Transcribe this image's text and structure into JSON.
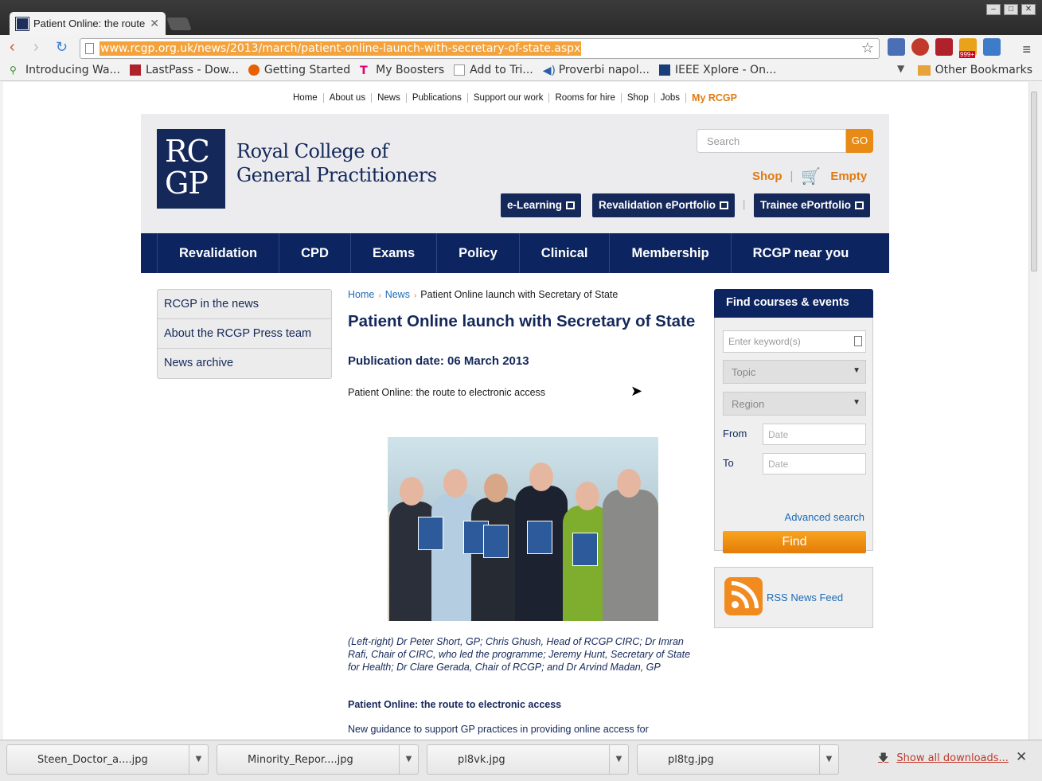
{
  "browser": {
    "tab_title": "Patient Online: the route",
    "url": "www.rcgp.org.uk/news/2013/march/patient-online-launch-with-secretary-of-state.aspx",
    "bookmarks": [
      "Introducing Wa...",
      "LastPass - Dow...",
      "Getting Started",
      "My Boosters",
      "Add to Tri...",
      "Proverbi napol...",
      "IEEE Xplore - On..."
    ],
    "other_bookmarks": "Other Bookmarks",
    "ext_badge": "999+"
  },
  "site": {
    "util_nav": [
      "Home",
      "About us",
      "News",
      "Publications",
      "Support our work",
      "Rooms for hire",
      "Shop",
      "Jobs",
      "My RCGP"
    ],
    "logo_mark_1": "RC",
    "logo_mark_2": "GP",
    "logo_line_1": "Royal College of",
    "logo_line_2": "General Practitioners",
    "search_placeholder": "Search",
    "go": "GO",
    "shop": "Shop",
    "sep": "|",
    "basket": "Empty",
    "elearning": "e-Learning",
    "revalidation_portfolio": "Revalidation ePortfolio",
    "trainee_portfolio": "Trainee ePortfolio",
    "main_nav": [
      "Revalidation",
      "CPD",
      "Exams",
      "Policy",
      "Clinical",
      "Membership",
      "RCGP near you"
    ]
  },
  "sidebar": [
    "RCGP in the news",
    "About the RCGP Press team",
    "News archive"
  ],
  "article": {
    "crumbs": [
      "Home",
      "News",
      "Patient Online launch with Secretary of State"
    ],
    "title": "Patient Online launch with Secretary of State",
    "pub_date": "Publication date: 06 March 2013",
    "subtitle": "Patient Online: the route to electronic access",
    "caption": "(Left-right) Dr Peter Short, GP; Chris Ghush, Head of RCGP CIRC; Dr Imran Rafi, Chair of CIRC, who led the programme; Jeremy Hunt, Secretary of State for Health; Dr Clare Gerada, Chair of RCGP; and Dr Arvind Madan, GP",
    "subheading": "Patient Online: the route to electronic access",
    "body": "New guidance to support GP practices in providing online access for"
  },
  "courses": {
    "heading": "Find courses & events",
    "keyword_placeholder": "Enter keyword(s)",
    "topic": "Topic",
    "region": "Region",
    "from_label": "From",
    "to_label": "To",
    "date_placeholder": "Date",
    "advanced": "Advanced search",
    "find": "Find",
    "rss": "RSS News Feed"
  },
  "downloads": {
    "items": [
      "Steen_Doctor_a....jpg",
      "Minority_Repor....jpg",
      "pl8vk.jpg",
      "pl8tg.jpg"
    ],
    "show_all": "Show all downloads..."
  },
  "colors": {
    "navy": "#0c2560",
    "orange": "#e07b13",
    "link": "#1c6bb6"
  }
}
